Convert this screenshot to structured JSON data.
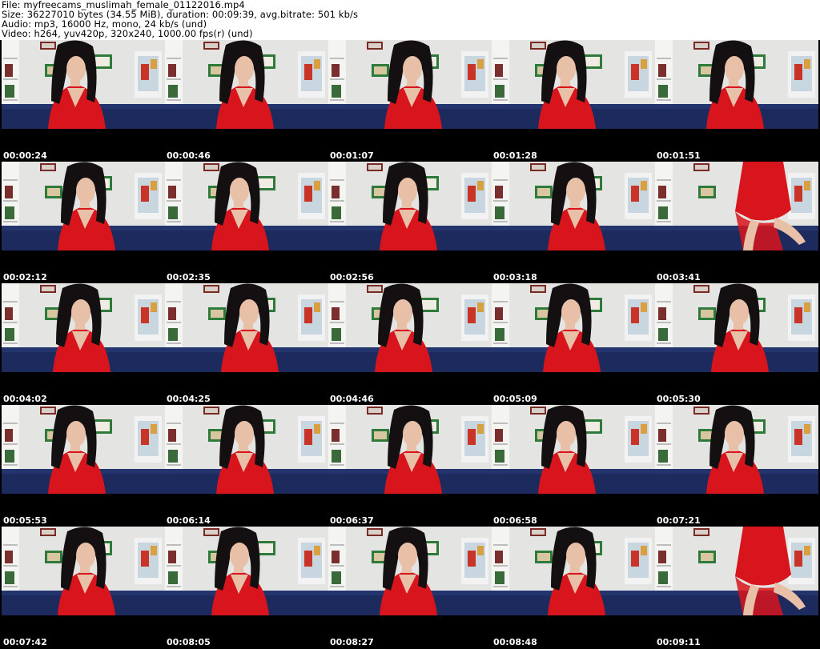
{
  "header": {
    "file": "File: myfreecams_muslimah_female_01122016.mp4",
    "size": "Size: 36227010 bytes (34.55 MiB), duration: 00:09:39, avg.bitrate: 501 kb/s",
    "audio": "Audio: mp3, 16000 Hz, mono, 24 kb/s (und)",
    "video": "Video: h264, yuv420p, 320x240, 1000.00 fps(r) (und)"
  },
  "thumbnails": [
    {
      "timestamp": "00:00:24",
      "pose": "seated"
    },
    {
      "timestamp": "00:00:46",
      "pose": "seated"
    },
    {
      "timestamp": "00:01:07",
      "pose": "seated"
    },
    {
      "timestamp": "00:01:28",
      "pose": "seated"
    },
    {
      "timestamp": "00:01:51",
      "pose": "seated"
    },
    {
      "timestamp": "00:02:12",
      "pose": "seated"
    },
    {
      "timestamp": "00:02:35",
      "pose": "seated"
    },
    {
      "timestamp": "00:02:56",
      "pose": "seated"
    },
    {
      "timestamp": "00:03:18",
      "pose": "seated"
    },
    {
      "timestamp": "00:03:41",
      "pose": "standing"
    },
    {
      "timestamp": "00:04:02",
      "pose": "seated"
    },
    {
      "timestamp": "00:04:25",
      "pose": "seated"
    },
    {
      "timestamp": "00:04:46",
      "pose": "seated"
    },
    {
      "timestamp": "00:05:09",
      "pose": "seated"
    },
    {
      "timestamp": "00:05:30",
      "pose": "seated"
    },
    {
      "timestamp": "00:05:53",
      "pose": "seated"
    },
    {
      "timestamp": "00:06:14",
      "pose": "seated"
    },
    {
      "timestamp": "00:06:37",
      "pose": "seated"
    },
    {
      "timestamp": "00:06:58",
      "pose": "seated"
    },
    {
      "timestamp": "00:07:21",
      "pose": "seated"
    },
    {
      "timestamp": "00:07:42",
      "pose": "seated"
    },
    {
      "timestamp": "00:08:05",
      "pose": "seated"
    },
    {
      "timestamp": "00:08:27",
      "pose": "seated"
    },
    {
      "timestamp": "00:08:48",
      "pose": "seated"
    },
    {
      "timestamp": "00:09:11",
      "pose": "standing"
    }
  ],
  "colors": {
    "background": "#ffffff",
    "sheet": "#000000",
    "timestamp_text": "#ffffff",
    "wall": "#e4e4e2",
    "couch": "#1c2a5e",
    "dress": "#d8141c",
    "hair": "#141012",
    "skin": "#e8c0a8"
  }
}
